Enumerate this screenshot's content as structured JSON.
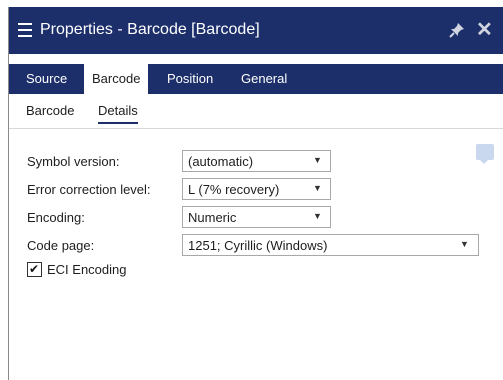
{
  "window": {
    "title": "Properties - Barcode [Barcode]",
    "menu_icon": "hamburger-menu-icon",
    "pin_icon": "pin-icon",
    "close_icon": "close-icon"
  },
  "tabs": [
    {
      "label": "Source",
      "active": false
    },
    {
      "label": "Barcode",
      "active": true
    },
    {
      "label": "Position",
      "active": false
    },
    {
      "label": "General",
      "active": false
    }
  ],
  "subtabs": [
    {
      "label": "Barcode",
      "active": false
    },
    {
      "label": "Details",
      "active": true
    }
  ],
  "form": {
    "symbol_version": {
      "label": "Symbol version:",
      "value": "(automatic)"
    },
    "error_correction": {
      "label": "Error correction level:",
      "value": "L (7% recovery)"
    },
    "encoding": {
      "label": "Encoding:",
      "value": "Numeric"
    },
    "code_page": {
      "label": "Code page:",
      "value": "1251; Cyrillic (Windows)"
    },
    "eci_encoding": {
      "label": "ECI Encoding",
      "checked": true
    }
  },
  "help_icon": "help-tooltip-icon",
  "colors": {
    "accent": "#1c2f6b",
    "help": "#c9d8ee"
  }
}
